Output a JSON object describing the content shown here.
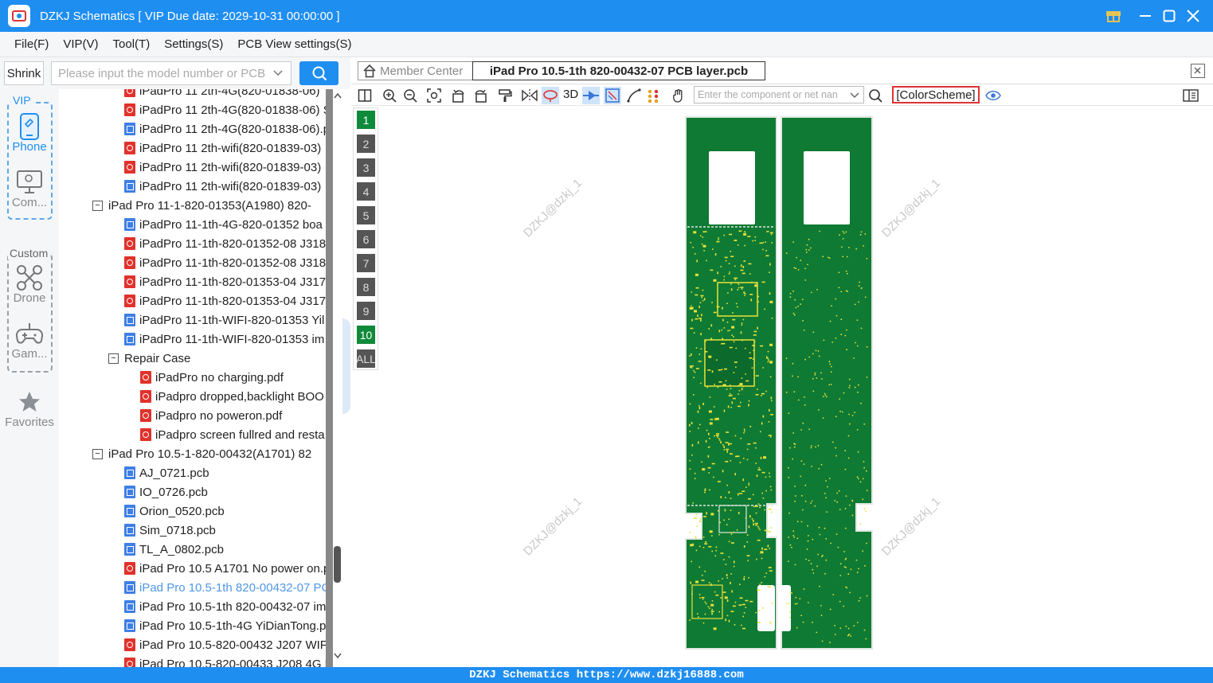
{
  "window": {
    "title": "DZKJ Schematics [ VIP Due date: 2029-10-31 00:00:00 ]"
  },
  "menu": [
    "File(F)",
    "VIP(V)",
    "Tool(T)",
    "Settings(S)",
    "PCB View settings(S)"
  ],
  "left_toolbar": {
    "shrink_label": "Shrink",
    "search_placeholder": "Please input the model number or PCB"
  },
  "sidebar": {
    "vip_label": "VIP",
    "custom_label": "Custom",
    "items": [
      {
        "label": "Phone",
        "icon": "phone-icon",
        "active": true
      },
      {
        "label": "Com...",
        "icon": "computer-icon",
        "active": false
      },
      {
        "label": "Drone",
        "icon": "drone-icon",
        "active": false
      },
      {
        "label": "Gam...",
        "icon": "gamepad-icon",
        "active": false
      },
      {
        "label": "Favorites",
        "icon": "star-icon",
        "active": false
      }
    ]
  },
  "tree": [
    {
      "text": "iPadPro 11 2th-4G(820-01838-06)",
      "type": "pdf",
      "indent": 2
    },
    {
      "text": "iPadPro 11 2th-4G(820-01838-06) S",
      "type": "pdf",
      "indent": 2
    },
    {
      "text": "iPadPro 11 2th-4G(820-01838-06).p",
      "type": "pcb",
      "indent": 2
    },
    {
      "text": "iPadPro 11 2th-wifi(820-01839-03)",
      "type": "pdf",
      "indent": 2
    },
    {
      "text": "iPadPro 11 2th-wifi(820-01839-03)",
      "type": "pdf",
      "indent": 2
    },
    {
      "text": "iPadPro 11 2th-wifi(820-01839-03)",
      "type": "pcb",
      "indent": 2
    },
    {
      "text": "iPad Pro 11-1-820-01353(A1980) 820-",
      "type": "folder",
      "indent": 1
    },
    {
      "text": "iPadPro 11-1th-4G-820-01352 boa",
      "type": "pcb",
      "indent": 2
    },
    {
      "text": "iPadPro 11-1th-820-01352-08 J318",
      "type": "pdf",
      "indent": 2
    },
    {
      "text": "iPadPro 11-1th-820-01352-08 J318",
      "type": "pdf",
      "indent": 2
    },
    {
      "text": "iPadPro 11-1th-820-01353-04 J317",
      "type": "pdf",
      "indent": 2
    },
    {
      "text": "iPadPro 11-1th-820-01353-04 J317",
      "type": "pdf",
      "indent": 2
    },
    {
      "text": "iPadPro 11-1th-WIFI-820-01353 Yil",
      "type": "pcb",
      "indent": 2
    },
    {
      "text": "iPadPro 11-1th-WIFI-820-01353 im",
      "type": "pcb",
      "indent": 2
    },
    {
      "text": "Repair Case",
      "type": "folder",
      "indent": 2
    },
    {
      "text": "iPadPro no charging.pdf",
      "type": "pdf",
      "indent": 3
    },
    {
      "text": "iPadpro dropped,backlight BOO",
      "type": "pdf",
      "indent": 3
    },
    {
      "text": "iPadpro no poweron.pdf",
      "type": "pdf",
      "indent": 3
    },
    {
      "text": "iPadpro screen fullred and resta",
      "type": "pdf",
      "indent": 3
    },
    {
      "text": "iPad Pro 10.5-1-820-00432(A1701) 82",
      "type": "folder",
      "indent": 1
    },
    {
      "text": "AJ_0721.pcb",
      "type": "pcb",
      "indent": 2
    },
    {
      "text": "IO_0726.pcb",
      "type": "pcb",
      "indent": 2
    },
    {
      "text": "Orion_0520.pcb",
      "type": "pcb",
      "indent": 2
    },
    {
      "text": "Sim_0718.pcb",
      "type": "pcb",
      "indent": 2
    },
    {
      "text": "TL_A_0802.pcb",
      "type": "pcb",
      "indent": 2
    },
    {
      "text": "iPad Pro 10.5 A1701 No power on.p",
      "type": "pdf",
      "indent": 2
    },
    {
      "text": "iPad Pro 10.5-1th 820-00432-07 PC",
      "type": "pcb",
      "indent": 2,
      "selected": true
    },
    {
      "text": "iPad Pro 10.5-1th 820-00432-07 im",
      "type": "pcb",
      "indent": 2
    },
    {
      "text": "iPad Pro 10.5-1th-4G YiDianTong.p",
      "type": "pcb",
      "indent": 2
    },
    {
      "text": "iPad Pro 10.5-820-00432 J207 WIFI",
      "type": "pdf",
      "indent": 2
    },
    {
      "text": "iPad Pro 10.5-820-00433 J208 4G L",
      "type": "pdf",
      "indent": 2
    }
  ],
  "tabs": {
    "member_center": "Member Center",
    "active_file": "iPad Pro 10.5-1th 820-00432-07 PCB layer.pcb"
  },
  "toolbar": {
    "three_d_label": "3D",
    "component_placeholder": "Enter the component or net nan",
    "color_scheme_label": "[ColorScheme]"
  },
  "layers": {
    "buttons": [
      "1",
      "2",
      "3",
      "4",
      "5",
      "6",
      "7",
      "8",
      "9",
      "10",
      "ALL"
    ],
    "active": [
      "1",
      "10"
    ]
  },
  "watermark_text": "DZKJ@dzkj_1",
  "footer": "DZKJ Schematics https://www.dzkj16888.com",
  "colors": {
    "accent": "#1f8ef1",
    "board_green": "#0f7a34",
    "pad_yellow": "#e8e23a",
    "selected_text": "#4f97e6"
  }
}
